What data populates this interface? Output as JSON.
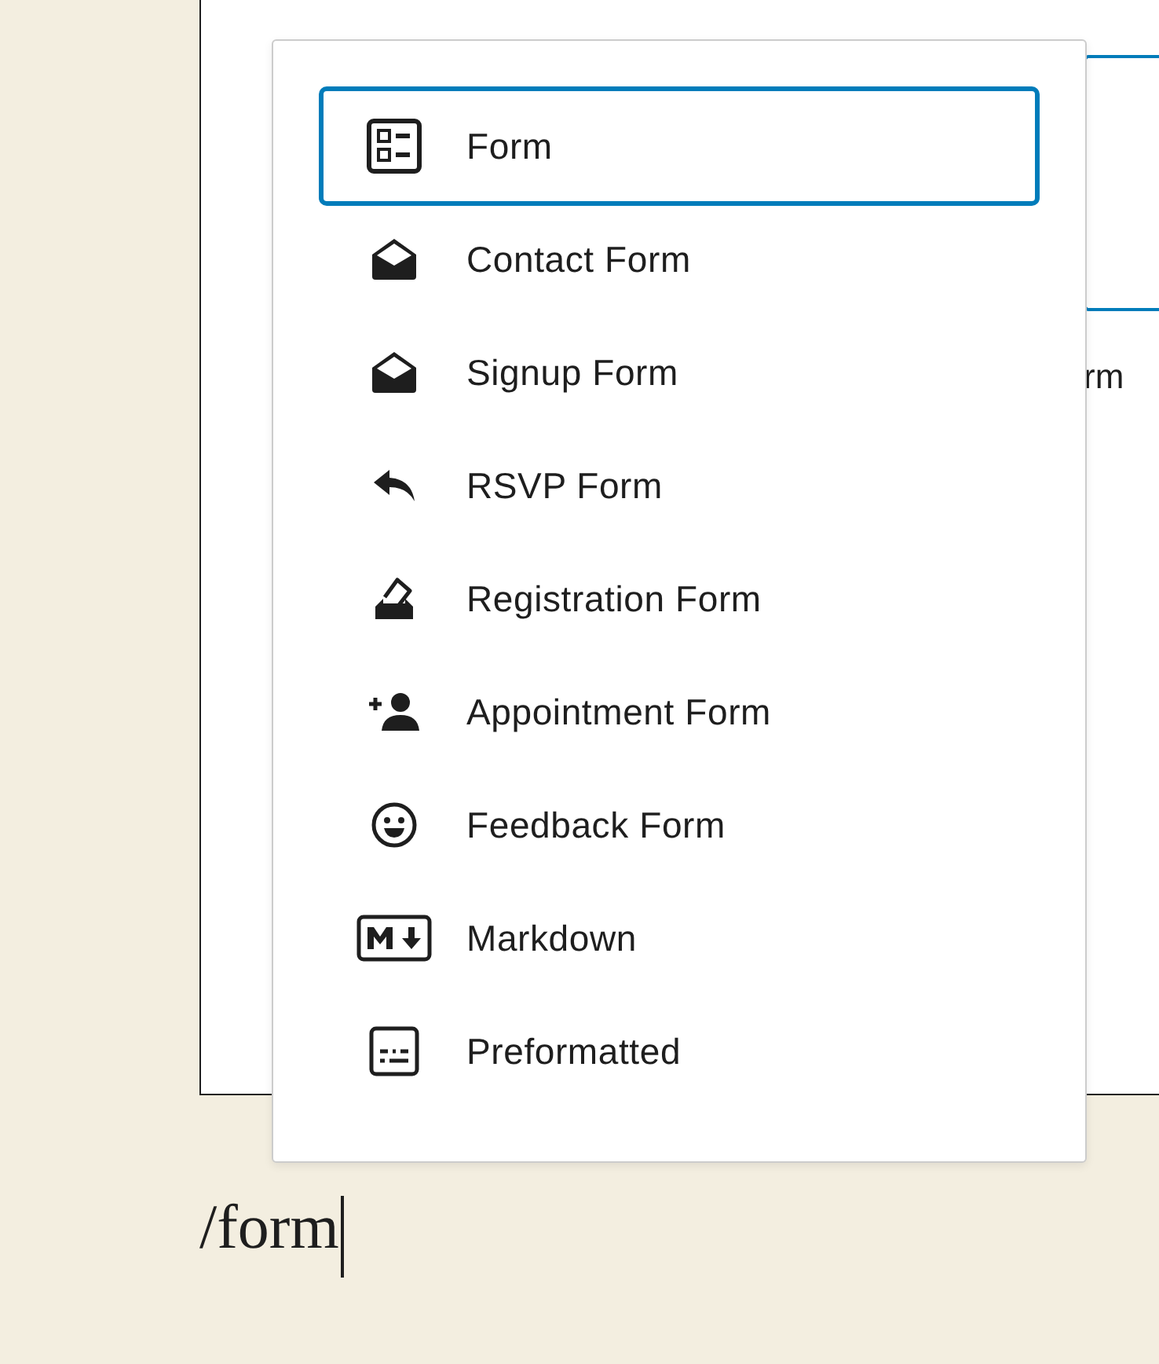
{
  "background_block": {
    "partial_text": "rm"
  },
  "menu": {
    "items": [
      {
        "label": "Form",
        "kind": "form",
        "selected": true
      },
      {
        "label": "Contact Form",
        "kind": "envelope",
        "selected": false
      },
      {
        "label": "Signup Form",
        "kind": "envelope",
        "selected": false
      },
      {
        "label": "RSVP Form",
        "kind": "reply",
        "selected": false
      },
      {
        "label": "Registration Form",
        "kind": "ballot",
        "selected": false
      },
      {
        "label": "Appointment Form",
        "kind": "person",
        "selected": false
      },
      {
        "label": "Feedback Form",
        "kind": "smiley",
        "selected": false
      },
      {
        "label": "Markdown",
        "kind": "markdown",
        "selected": false
      },
      {
        "label": "Preformatted",
        "kind": "preformatted",
        "selected": false
      }
    ]
  },
  "editor": {
    "value": "/form"
  }
}
